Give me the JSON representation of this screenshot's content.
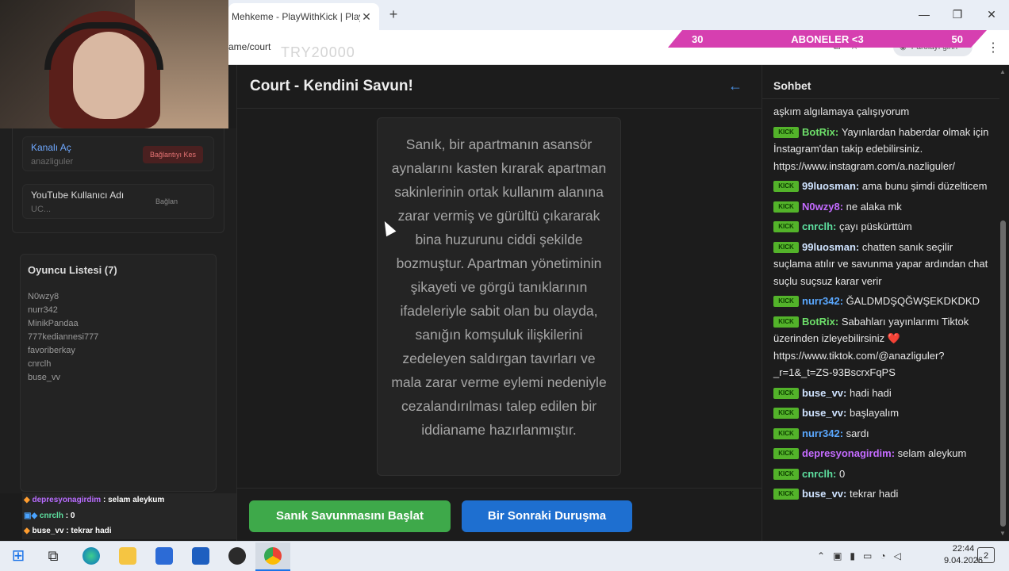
{
  "browser": {
    "tab_title": "Mehkeme - PlayWithKick | PlayWithKick",
    "new_tab": "+",
    "url_fragment": "ame/court",
    "ghost_text": "TRY20000",
    "profile_label": "Parolayı girin",
    "window_controls": {
      "minimize": "—",
      "restore": "❐",
      "close": "✕"
    }
  },
  "sub_goal": {
    "left": "30",
    "label": "ABONELER <3",
    "right": "50"
  },
  "left_panel": {
    "connections": [
      {
        "title": "Kanalı Aç",
        "subtitle": "anazliguler",
        "action": "Bağlantıyı Kes"
      },
      {
        "title": "YouTube Kullanıcı Adı",
        "subtitle": "UC...",
        "action": "Bağlan"
      }
    ],
    "players_title": "Oyuncu Listesi (7)",
    "players": [
      "N0wzy8",
      "nurr342",
      "MinikPandaa",
      "777kediannesi777",
      "favoriberkay",
      "cnrclh",
      "buse_vv"
    ]
  },
  "obs_chat": [
    {
      "user": "depresyonagirdim",
      "text": ": selam aleykum",
      "color": "#b86cff"
    },
    {
      "user": "cnrclh",
      "text": ": 0",
      "color": "#5ee0a0"
    },
    {
      "user": "buse_vv",
      "text": ": tekrar hadi",
      "color": "#ffffff"
    }
  ],
  "main": {
    "title": "Court - Kendini Savun!",
    "indictment": "Sanık, bir apartmanın asansör aynalarını kasten kırarak apartman sakinlerinin ortak kullanım alanına zarar vermiş ve gürültü çıkararak bina huzurunu ciddi şekilde bozmuştur. Apartman yönetiminin şikayeti ve görgü tanıklarının ifadeleriyle sabit olan bu olayda, sanığın komşuluk ilişkilerini zedeleyen saldırgan tavırları ve mala zarar verme eylemi nedeniyle cezalandırılması talep edilen bir iddianame hazırlanmıştır.",
    "btn_start": "Sanık Savunmasını Başlat",
    "btn_next": "Bir Sonraki Duruşma"
  },
  "chat": {
    "title": "Sohbet",
    "partial_top": "aşkım algılamaya çalışıyorum",
    "badge": "KICK",
    "messages": [
      {
        "user": "BotRix",
        "color": "#6ee06a",
        "text": "Yayınlardan haberdar olmak için İnstagram'dan takip edebilirsiniz. https://www.instagram.com/a.nazliguler/"
      },
      {
        "user": "99luosman",
        "color": "#cfe3ff",
        "text": "ama bunu şimdi düzelticem"
      },
      {
        "user": "N0wzy8",
        "color": "#c46bff",
        "text": "ne alaka mk"
      },
      {
        "user": "cnrclh",
        "color": "#5ee0a0",
        "text": "çayı püskürttüm"
      },
      {
        "user": "99luosman",
        "color": "#cfe3ff",
        "text": "chatten sanık seçilir suçlama atılır ve savunma yapar ardından chat suçlu suçsuz karar verir"
      },
      {
        "user": "nurr342",
        "color": "#5aa8ff",
        "text": "ĞALDMDŞQĞWŞEKDKDKD"
      },
      {
        "user": "BotRix",
        "color": "#6ee06a",
        "text": "Sabahları yayınlarımı Tiktok üzerinden izleyebilirsiniz ❤️ https://www.tiktok.com/@anazliguler?_r=1&_t=ZS-93BscrxFqPS"
      },
      {
        "user": "buse_vv",
        "color": "#cfe3ff",
        "text": "hadi hadi"
      },
      {
        "user": "buse_vv",
        "color": "#cfe3ff",
        "text": "başlayalım"
      },
      {
        "user": "nurr342",
        "color": "#5aa8ff",
        "text": "sardı"
      },
      {
        "user": "depresyonagirdim",
        "color": "#c46bff",
        "text": "selam aleykum"
      },
      {
        "user": "cnrclh",
        "color": "#5ee0a0",
        "text": "0"
      },
      {
        "user": "buse_vv",
        "color": "#cfe3ff",
        "text": "tekrar hadi"
      }
    ]
  },
  "taskbar": {
    "time": "22:44",
    "date": "9.04.2026",
    "notifications": "2"
  }
}
